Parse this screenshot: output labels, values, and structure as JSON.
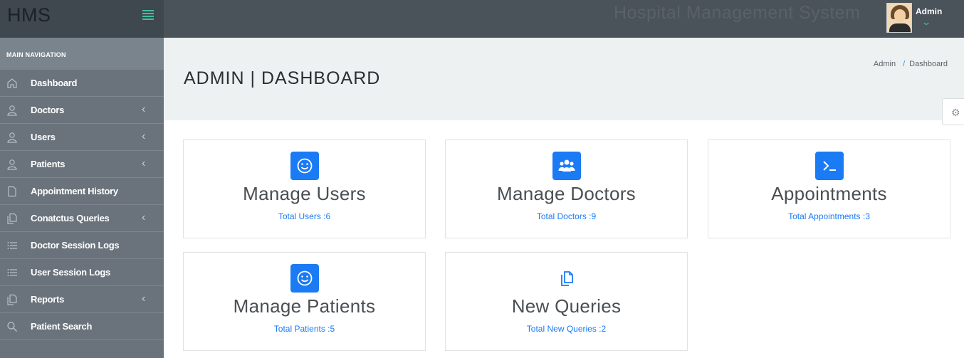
{
  "brand": "HMS",
  "header": {
    "title": "Hospital Management System",
    "user": {
      "name": "Admin"
    }
  },
  "sidebar": {
    "heading": "MAIN NAVIGATION",
    "items": [
      {
        "label": "Dashboard",
        "icon": "home-icon",
        "has_children": false
      },
      {
        "label": "Doctors",
        "icon": "user-icon",
        "has_children": true
      },
      {
        "label": "Users",
        "icon": "user-icon",
        "has_children": true
      },
      {
        "label": "Patients",
        "icon": "user-icon",
        "has_children": true
      },
      {
        "label": "Appointment History",
        "icon": "file-icon",
        "has_children": false
      },
      {
        "label": "Conatctus Queries",
        "icon": "files-icon",
        "has_children": true
      },
      {
        "label": "Doctor Session Logs",
        "icon": "list-icon",
        "has_children": false
      },
      {
        "label": "User Session Logs",
        "icon": "list-icon",
        "has_children": false
      },
      {
        "label": "Reports",
        "icon": "files-icon",
        "has_children": true
      },
      {
        "label": "Patient Search",
        "icon": "search-icon",
        "has_children": false
      }
    ]
  },
  "page": {
    "title": "ADMIN | DASHBOARD",
    "breadcrumb": [
      "Admin",
      "Dashboard"
    ]
  },
  "cards": [
    {
      "title": "Manage Users",
      "link": "Total Users :6",
      "icon": "smile-icon"
    },
    {
      "title": "Manage Doctors",
      "link": "Total Doctors :9",
      "icon": "users-icon"
    },
    {
      "title": "Appointments",
      "link": "Total Appointments :3",
      "icon": "terminal-icon"
    },
    {
      "title": "Manage Patients",
      "link": "Total Patients :5",
      "icon": "smile-icon"
    },
    {
      "title": "New Queries",
      "link": "Total New Queries :2",
      "icon": "files-icon"
    }
  ],
  "colors": {
    "accent": "#1a7bf4",
    "topbar": "#4a525a",
    "sidebar": "#6a737b",
    "toggle": "#3fbfa0"
  }
}
